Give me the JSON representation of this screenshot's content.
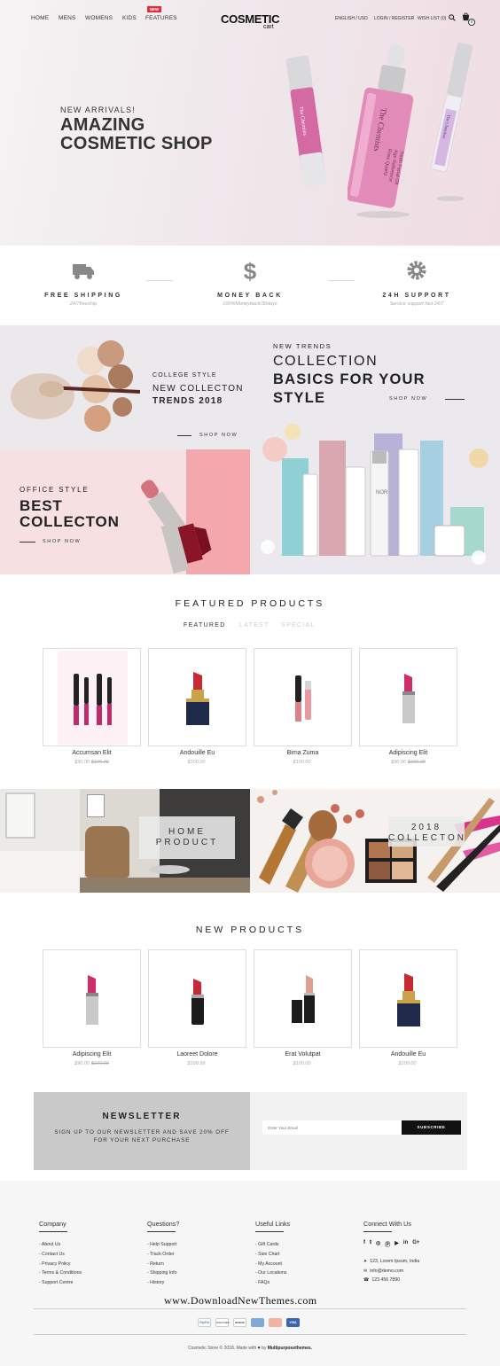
{
  "header": {
    "nav": [
      "HOME",
      "MENS",
      "WOMENS",
      "KIDS",
      "FEATURES"
    ],
    "new_badge": "NEW",
    "logo_main": "COSMETIC",
    "logo_sub": "cart",
    "language": "ENGLISH / USD",
    "login": "LOGIN / REGISTER",
    "wishlist": "WISH LIST (0)",
    "cart_count": "0"
  },
  "hero": {
    "subtitle": "NEW ARRIVALS!",
    "title_line1": "AMAZING",
    "title_line2": "COSMETIC SHOP",
    "product_brand": "The Chemists",
    "product_lines": [
      "Rose Quartz",
      "Age Reference",
      "Youth Facial Oil"
    ]
  },
  "features": [
    {
      "title": "FREE SHIPPING",
      "sub": "24/7freeship",
      "icon": "truck-icon"
    },
    {
      "title": "MONEY BACK",
      "sub": "100%Moneyback/30days",
      "icon": "dollar-icon"
    },
    {
      "title": "24H SUPPORT",
      "sub": "Service support fast 24/7",
      "icon": "gear-icon"
    }
  ],
  "promo": {
    "college": {
      "line1": "COLLEGE STYLE",
      "line2": "NEW COLLECTON",
      "line3": "TRENDS 2018",
      "cta": "SHOP NOW"
    },
    "office": {
      "line1": "OFFICE STYLE",
      "line2": "BEST",
      "line3": "COLLECTON",
      "cta": "SHOP NOW"
    },
    "trends": {
      "line1": "NEW TRENDS",
      "line2": "COLLECTION",
      "line3": "BASICS FOR YOUR",
      "line4": "STYLE",
      "cta": "SHOP NOW",
      "brand": "NOR"
    }
  },
  "featured": {
    "title": "FEATURED PRODUCTS",
    "tabs": [
      "FEATURED",
      "LATEST",
      "SPECIAL"
    ],
    "products": [
      {
        "name": "Accumsan Elit",
        "price": "$90.00",
        "old": "$100.00"
      },
      {
        "name": "Andouille Eu",
        "price": "$100.00",
        "old": ""
      },
      {
        "name": "Bima Zuma",
        "price": "$100.00",
        "old": ""
      },
      {
        "name": "Adipiscing Elit",
        "price": "$90.00",
        "old": "$100.00"
      }
    ]
  },
  "banners": {
    "home": [
      "HOME",
      "PRODUCT"
    ],
    "collection": [
      "2018",
      "COLLECTON"
    ]
  },
  "new_products": {
    "title": "NEW PRODUCTS",
    "products": [
      {
        "name": "Adipiscing Elit",
        "price": "$90.00",
        "old": "$100.00"
      },
      {
        "name": "Laoreet Dolore",
        "price": "$199.99",
        "old": ""
      },
      {
        "name": "Erat Volutpat",
        "price": "$100.00",
        "old": ""
      },
      {
        "name": "Andouille Eu",
        "price": "$100.00",
        "old": ""
      }
    ]
  },
  "newsletter": {
    "title": "NEWSLETTER",
    "sub1": "SIGN UP TO OUR NEWSLETTER AND SAVE 20% OFF",
    "sub2": "FOR YOUR NEXT PURCHASE",
    "placeholder": "Enter Your Email",
    "button": "SUBSCRIBE"
  },
  "footer": {
    "company": {
      "title": "Company",
      "items": [
        "About Us",
        "Contact Us",
        "Privacy Policy",
        "Terms & Conditions",
        "Support Centre"
      ]
    },
    "questions": {
      "title": "Questions?",
      "items": [
        "Help Support",
        "Track Order",
        "Return",
        "Shipping Info",
        "History"
      ]
    },
    "links": {
      "title": "Useful Links",
      "items": [
        "Gift Cards",
        "Size Chart",
        "My Account",
        "Our Locations",
        "FAQs"
      ]
    },
    "connect": {
      "title": "Connect With Us",
      "address": "123, Lorem Ipsum, India",
      "email": "info@demo.com",
      "phone": "123 456 7890"
    },
    "watermark": "www.DownloadNewThemes.com",
    "payments": [
      "PayPal",
      "DISCOVER",
      "amazon",
      "",
      "",
      "VISA"
    ],
    "copyright_a": "Cosmetic Store © 2018. Made with",
    "copyright_b": "by",
    "copyright_c": "Multipurposethemes."
  },
  "colors": {
    "accent": "#e52b3a",
    "dark": "#111111",
    "hero_pink": "#f0dde4"
  }
}
